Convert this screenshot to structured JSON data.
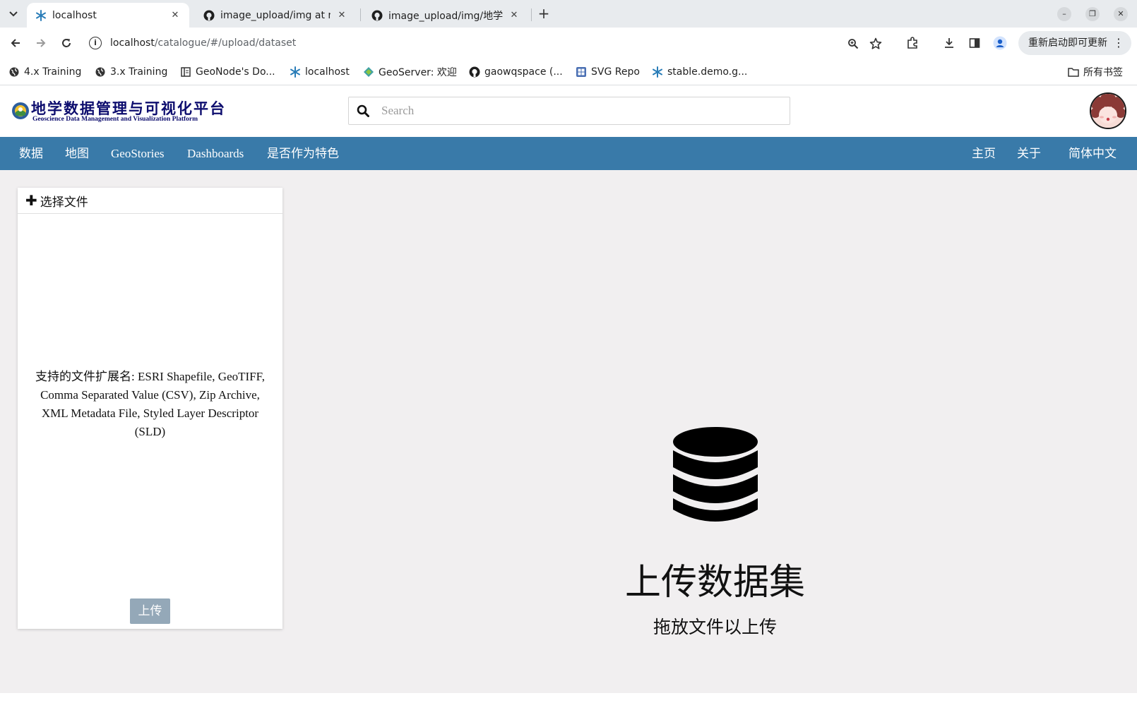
{
  "browser": {
    "tabs": [
      {
        "title": "localhost",
        "active": true
      },
      {
        "title": "image_upload/img at m",
        "active": false
      },
      {
        "title": "image_upload/img/地学",
        "active": false
      }
    ],
    "address": {
      "host": "localhost",
      "path": "/catalogue/#/upload/dataset"
    },
    "update_button": "重新启动即可更新",
    "bookmarks": [
      {
        "label": "4.x Training",
        "icon": "globe-icon"
      },
      {
        "label": "3.x Training",
        "icon": "globe-icon"
      },
      {
        "label": "GeoNode's Do...",
        "icon": "docs-icon"
      },
      {
        "label": "localhost",
        "icon": "snowflake-icon"
      },
      {
        "label": "GeoServer: 欢迎",
        "icon": "geoserver-icon"
      },
      {
        "label": "gaowqspace (...",
        "icon": "github-icon"
      },
      {
        "label": "SVG Repo",
        "icon": "svgrepo-icon"
      },
      {
        "label": "stable.demo.g...",
        "icon": "snowflake-icon"
      }
    ],
    "all_bookmarks": "所有书签"
  },
  "site": {
    "logo": {
      "title_cn": "地学数据管理与可视化平台",
      "title_en": "Geoscience Data Management and Visualization Platform"
    },
    "search": {
      "placeholder": "Search"
    },
    "nav_left": [
      "数据",
      "地图",
      "GeoStories",
      "Dashboards",
      "是否作为特色"
    ],
    "nav_right": [
      "主页",
      "关于",
      "简体中文"
    ]
  },
  "upload_panel": {
    "choose_files": "选择文件",
    "supported_text": "支持的文件扩展名: ESRI Shapefile, GeoTIFF, Comma Separated Value (CSV), Zip Archive, XML Metadata File, Styled Layer Descriptor (SLD)",
    "upload_button": "上传"
  },
  "drop_zone": {
    "icon": "database-icon",
    "title": "上传数据集",
    "subtitle": "拖放文件以上传"
  },
  "colors": {
    "navbar": "#397aa9",
    "upload_button_disabled": "#94a8b8",
    "page_background": "#f1eff0"
  }
}
